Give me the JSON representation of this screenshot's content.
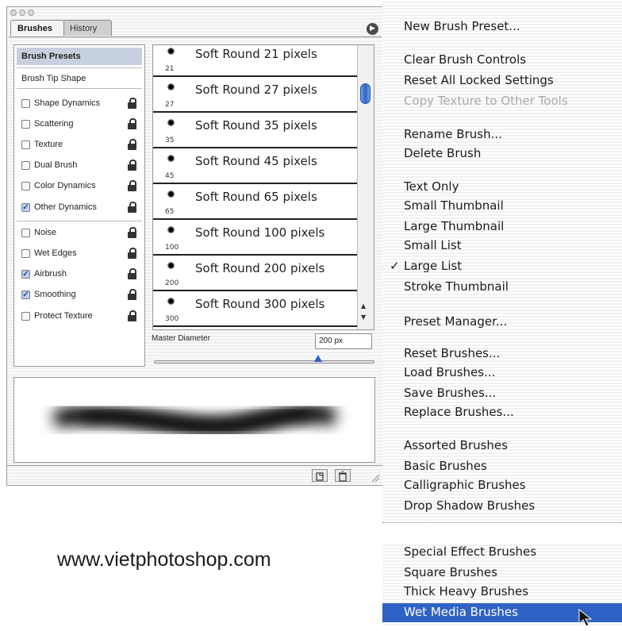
{
  "palette": {
    "tabs": {
      "brushes": "Brushes",
      "history": "History"
    },
    "left_list": {
      "brush_presets": "Brush Presets",
      "brush_tip_shape": "Brush Tip Shape",
      "options": [
        {
          "label": "Shape Dynamics",
          "checked": false
        },
        {
          "label": "Scattering",
          "checked": false
        },
        {
          "label": "Texture",
          "checked": false
        },
        {
          "label": "Dual Brush",
          "checked": false
        },
        {
          "label": "Color Dynamics",
          "checked": false
        },
        {
          "label": "Other Dynamics",
          "checked": true
        },
        {
          "label": "Noise",
          "checked": false
        },
        {
          "label": "Wet Edges",
          "checked": false
        },
        {
          "label": "Airbrush",
          "checked": true
        },
        {
          "label": "Smoothing",
          "checked": true
        },
        {
          "label": "Protect Texture",
          "checked": false
        }
      ]
    },
    "presets": [
      {
        "name": "Soft Round 21 pixels",
        "size": "21"
      },
      {
        "name": "Soft Round 27 pixels",
        "size": "27"
      },
      {
        "name": "Soft Round 35 pixels",
        "size": "35"
      },
      {
        "name": "Soft Round 45 pixels",
        "size": "45"
      },
      {
        "name": "Soft Round 65 pixels",
        "size": "65"
      },
      {
        "name": "Soft Round 100 pixels",
        "size": "100"
      },
      {
        "name": "Soft Round 200 pixels",
        "size": "200"
      },
      {
        "name": "Soft Round 300 pixels",
        "size": "300"
      }
    ],
    "master_diameter": {
      "label": "Master Diameter",
      "value": "200 px"
    }
  },
  "menu": {
    "items": [
      {
        "label": "New Brush Preset..."
      },
      {
        "label": "Clear Brush Controls"
      },
      {
        "label": "Reset All Locked Settings"
      },
      {
        "label": "Copy Texture to Other Tools",
        "disabled": true
      },
      {
        "label": "Rename Brush..."
      },
      {
        "label": "Delete Brush"
      },
      {
        "label": "Text Only"
      },
      {
        "label": "Small Thumbnail"
      },
      {
        "label": "Large Thumbnail"
      },
      {
        "label": "Small List"
      },
      {
        "label": "Large List",
        "checked": true
      },
      {
        "label": "Stroke Thumbnail"
      },
      {
        "label": "Preset Manager..."
      },
      {
        "label": "Reset Brushes..."
      },
      {
        "label": "Load Brushes..."
      },
      {
        "label": "Save Brushes..."
      },
      {
        "label": "Replace Brushes..."
      },
      {
        "label": "Assorted Brushes"
      },
      {
        "label": "Basic Brushes"
      },
      {
        "label": "Calligraphic Brushes"
      },
      {
        "label": "Drop Shadow Brushes"
      },
      {
        "label": "Special Effect Brushes"
      },
      {
        "label": "Square Brushes"
      },
      {
        "label": "Thick Heavy Brushes"
      },
      {
        "label": "Wet Media Brushes",
        "highlighted": true
      }
    ],
    "check_mark": "✓"
  },
  "watermark": "www.vietphotoshop.com",
  "colors": {
    "highlight": "#2f62c4",
    "selection": "#c7d0df",
    "scroll_thumb": "#2f64c8"
  }
}
